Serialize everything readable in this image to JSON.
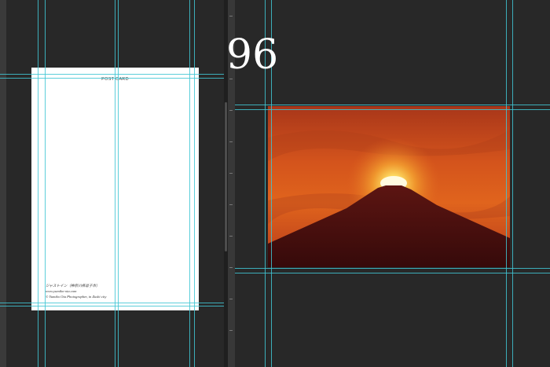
{
  "document": {
    "page_number": "96",
    "postcard": {
      "title": "POST CARD",
      "credits": [
        "ジャストイン（神奈川県逗子市）",
        "www.yumiko-ota.com",
        "© Yumiko Ota Photographer, in Zushi city"
      ]
    },
    "photo": {
      "subject": "red-sky-mountain-sunrise",
      "colors": {
        "sky_top": "#c2461a",
        "sky_mid": "#d95a1c",
        "sun_glow": "#fff6a8",
        "mountain": "#3e0d0c"
      }
    }
  },
  "workspace": {
    "background": "#282828",
    "guide_color": "#3fc6d4"
  }
}
